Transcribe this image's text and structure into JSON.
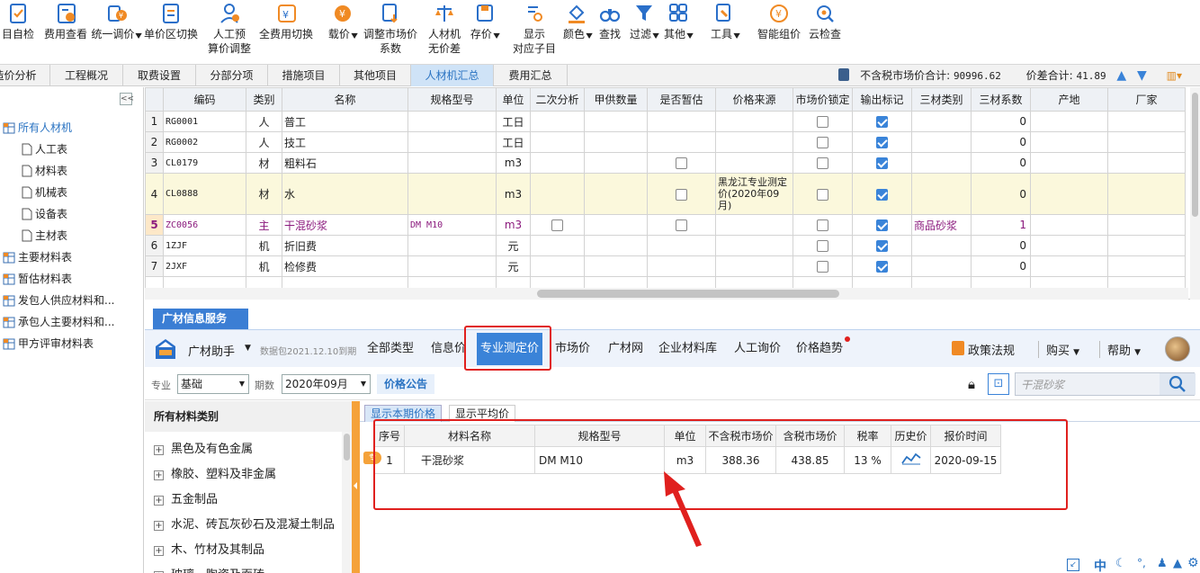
{
  "toolbar": [
    {
      "id": "self-check",
      "label": "目自检",
      "icon": "check-doc"
    },
    {
      "id": "fee-view",
      "label": "费用查看",
      "icon": "fee-calc"
    },
    {
      "id": "unify-price",
      "label": "统一调价",
      "icon": "adjust-price",
      "dropdown": true
    },
    {
      "id": "unit-switch",
      "label": "单价区切换",
      "icon": "switch-doc"
    },
    {
      "id": "labor-adjust",
      "label": "人工预",
      "label2": "算价调整",
      "icon": "labor-person"
    },
    {
      "id": "all-fee-switch",
      "label": "全费用切换",
      "icon": "cycle-coin"
    },
    {
      "id": "load-price",
      "label": "载价",
      "icon": "load-price",
      "dropdown": true
    },
    {
      "id": "adjust-market",
      "label": "调整市场价",
      "label2": "系数",
      "icon": "download-price"
    },
    {
      "id": "labor-machine",
      "label": "人材机",
      "label2": "无价差",
      "icon": "balance"
    },
    {
      "id": "save-price",
      "label": "存价",
      "icon": "save-disk",
      "dropdown": true
    },
    {
      "id": "show-sub",
      "label": "显示",
      "label2": "对应子目",
      "icon": "list-search"
    },
    {
      "id": "color",
      "label": "颜色",
      "icon": "paint-bucket",
      "dropdown": true
    },
    {
      "id": "find",
      "label": "查找",
      "icon": "binoculars"
    },
    {
      "id": "filter",
      "label": "过滤",
      "icon": "funnel",
      "dropdown": true
    },
    {
      "id": "other",
      "label": "其他",
      "icon": "grid-four",
      "dropdown": true
    },
    {
      "id": "tools",
      "label": "工具",
      "icon": "wrench",
      "dropdown": true
    },
    {
      "id": "smart-price",
      "label": "智能组价",
      "icon": "smart-coin"
    },
    {
      "id": "cloud-check",
      "label": "云检查",
      "icon": "cloud-search"
    }
  ],
  "tabs": [
    "造价分析",
    "工程概况",
    "取费设置",
    "分部分项",
    "措施项目",
    "其他项目",
    "人材机汇总",
    "费用汇总"
  ],
  "active_tab": "人材机汇总",
  "summary": {
    "tax_excl_label": "不含税市场价合计:",
    "tax_excl_value": "90996.62",
    "diff_label": "价差合计:",
    "diff_value": "41.89"
  },
  "tree": {
    "root": "所有人材机",
    "children": [
      "人工表",
      "材料表",
      "机械表",
      "设备表",
      "主材表"
    ],
    "others": [
      "主要材料表",
      "暂估材料表",
      "发包人供应材料和...",
      "承包人主要材料和...",
      "甲方评审材料表"
    ]
  },
  "grid": {
    "columns": [
      "编码",
      "类别",
      "名称",
      "规格型号",
      "单位",
      "二次分析",
      "甲供数量",
      "是否暂估",
      "价格来源",
      "市场价锁定",
      "输出标记",
      "三材类别",
      "三材系数",
      "产地",
      "厂家"
    ],
    "rows": [
      {
        "n": "1",
        "code": "RG0001",
        "cat": "人",
        "name": "普工",
        "spec": "",
        "unit": "工日",
        "sec": null,
        "jg": "",
        "est": null,
        "src": "",
        "lock": false,
        "out": true,
        "sancat": "",
        "sanco": "0"
      },
      {
        "n": "2",
        "code": "RG0002",
        "cat": "人",
        "name": "技工",
        "spec": "",
        "unit": "工日",
        "sec": null,
        "jg": "",
        "est": null,
        "src": "",
        "lock": false,
        "out": true,
        "sancat": "",
        "sanco": "0"
      },
      {
        "n": "3",
        "code": "CL0179",
        "cat": "材",
        "name": "粗料石",
        "spec": "",
        "unit": "m3",
        "sec": null,
        "jg": "",
        "est": false,
        "src": "",
        "lock": false,
        "out": true,
        "sancat": "",
        "sanco": "0"
      },
      {
        "n": "4",
        "code": "CL0888",
        "cat": "材",
        "name": "水",
        "spec": "",
        "unit": "m3",
        "sec": null,
        "jg": "",
        "est": false,
        "src": "黑龙江专业测定价(2020年09月)",
        "lock": false,
        "out": true,
        "sancat": "",
        "sanco": "0"
      },
      {
        "n": "5",
        "code": "ZC0056",
        "cat": "主",
        "name": "干混砂浆",
        "spec": "DM M10",
        "unit": "m3",
        "sec": false,
        "jg": "",
        "est": false,
        "src": "",
        "lock": false,
        "out": true,
        "sancat": "商品砂浆",
        "sanco": "1"
      },
      {
        "n": "6",
        "code": "1ZJF",
        "cat": "机",
        "name": "折旧费",
        "spec": "",
        "unit": "元",
        "sec": null,
        "jg": "",
        "est": null,
        "src": "",
        "lock": false,
        "out": true,
        "sancat": "",
        "sanco": "0"
      },
      {
        "n": "7",
        "code": "2JXF",
        "cat": "机",
        "name": "检修费",
        "spec": "",
        "unit": "元",
        "sec": null,
        "jg": "",
        "est": null,
        "src": "",
        "lock": false,
        "out": true,
        "sancat": "",
        "sanco": "0"
      }
    ]
  },
  "service": {
    "title": "广材信息服务",
    "assistant": "广材助手",
    "data_pkg": "数据包2021.12.10到期",
    "nav": [
      "全部类型",
      "信息价",
      "专业测定价",
      "市场价",
      "广材网",
      "企业材料库",
      "人工询价",
      "价格趋势"
    ],
    "active_nav": "专业测定价",
    "right": [
      "政策法规",
      "购买",
      "帮助"
    ],
    "filter": {
      "major_label": "专业",
      "major_value": "基础",
      "period_label": "期数",
      "period_value": "2020年09月",
      "notice": "价格公告",
      "search_placeholder": "干混砂浆"
    },
    "category_title": "所有材料类别",
    "categories": [
      "黑色及有色金属",
      "橡胶、塑料及非金属",
      "五金制品",
      "水泥、砖瓦灰砂石及混凝土制品",
      "木、竹材及其制品",
      "玻璃、陶瓷及面砖"
    ],
    "subtabs": [
      "显示本期价格",
      "显示平均价"
    ],
    "result_columns": [
      "序号",
      "材料名称",
      "规格型号",
      "单位",
      "不含税市场价",
      "含税市场价",
      "税率",
      "历史价",
      "报价时间"
    ],
    "result_rows": [
      {
        "n": "1",
        "name": "干混砂浆",
        "spec": "DM M10",
        "unit": "m3",
        "price_ex": "388.36",
        "price_in": "438.85",
        "rate": "13 %",
        "time": "2020-09-15"
      }
    ]
  },
  "status_bar": [
    "中"
  ],
  "colors": {
    "accent": "#3a83d8",
    "highlight": "#e0201e",
    "orange": "#f5a23a"
  }
}
